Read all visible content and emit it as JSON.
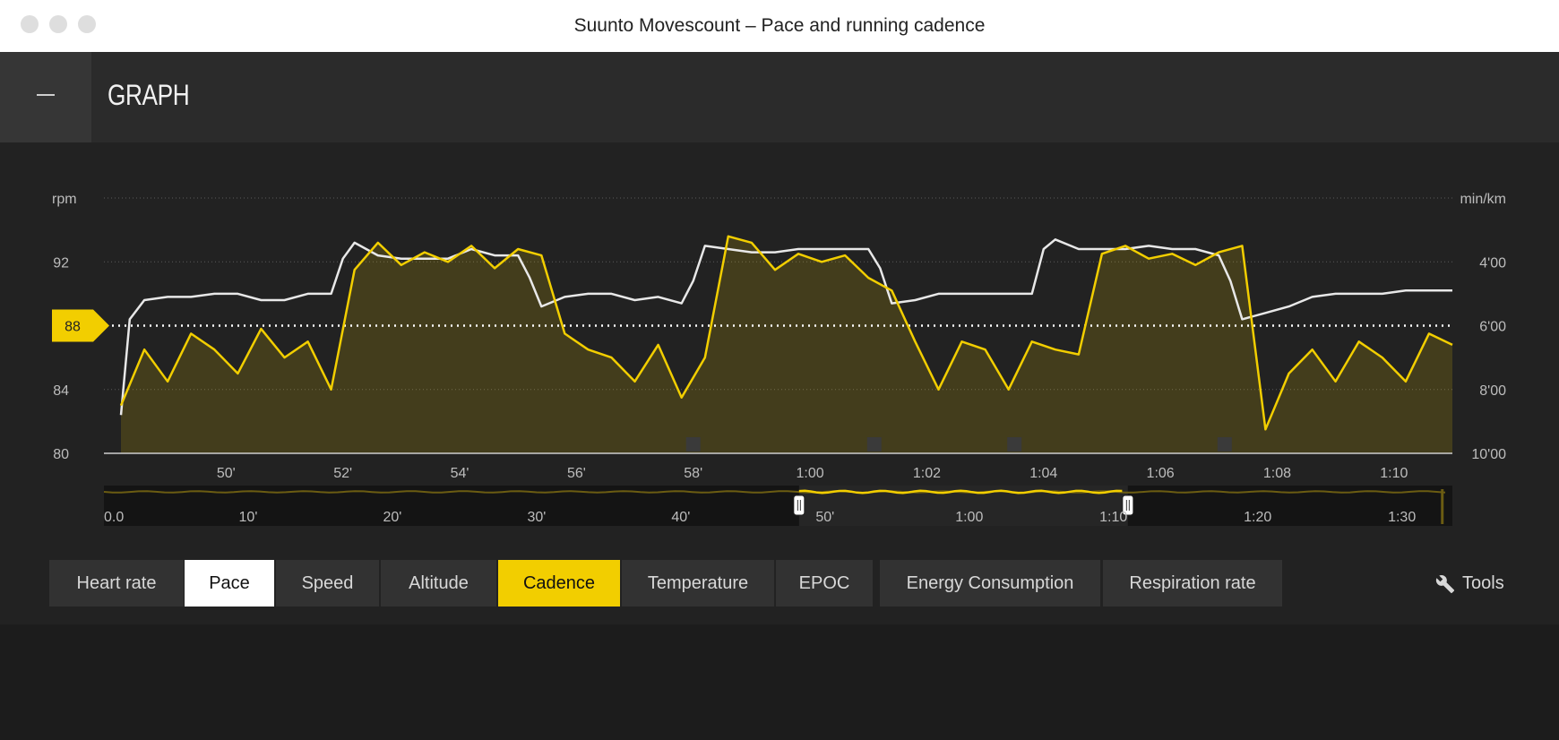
{
  "window": {
    "title": "Suunto Movescount – Pace and running cadence"
  },
  "header": {
    "title": "GRAPH"
  },
  "tabs": [
    "Heart rate",
    "Pace",
    "Speed",
    "Altitude",
    "Cadence",
    "Temperature",
    "EPOC",
    "Energy Consumption",
    "Respiration rate"
  ],
  "active_tabs": [
    "Pace",
    "Cadence"
  ],
  "tools": {
    "label": "Tools",
    "icon": "wrench-icon"
  },
  "colors": {
    "cadence": "#f2ce00",
    "pace": "#e8e8e8",
    "background": "#222222",
    "overlap_fill": "#f2ce00"
  },
  "chart_data": {
    "type": "line",
    "left_axis": {
      "unit": "rpm",
      "ticks": [
        92,
        88,
        84,
        80
      ],
      "range": [
        80,
        96
      ]
    },
    "right_axis": {
      "unit": "min/km",
      "ticks": [
        "4'00",
        "6'00",
        "8'00",
        "10'00"
      ],
      "range_min_per_km": [
        10,
        2
      ]
    },
    "x_axis": {
      "unit": "minutes",
      "ticks": [
        "50'",
        "52'",
        "54'",
        "56'",
        "58'",
        "1:00",
        "1:02",
        "1:04",
        "1:06",
        "1:08",
        "1:10"
      ],
      "range": [
        48.2,
        71.0
      ]
    },
    "marker": {
      "label": "88",
      "value": 88
    },
    "series": [
      {
        "name": "Cadence",
        "x": [
          48.2,
          48.6,
          49.0,
          49.4,
          49.8,
          50.2,
          50.6,
          51.0,
          51.4,
          51.8,
          52.2,
          52.6,
          53.0,
          53.4,
          53.8,
          54.2,
          54.6,
          55.0,
          55.4,
          55.8,
          56.2,
          56.6,
          57.0,
          57.4,
          57.8,
          58.2,
          58.6,
          59.0,
          59.4,
          59.8,
          60.2,
          60.6,
          61.0,
          61.4,
          61.8,
          62.2,
          62.6,
          63.0,
          63.4,
          63.8,
          64.2,
          64.6,
          65.0,
          65.4,
          65.8,
          66.2,
          66.6,
          67.0,
          67.4,
          67.8,
          68.2,
          68.6,
          69.0,
          69.4,
          69.8,
          70.2,
          70.6,
          71.0
        ],
        "values": [
          83.0,
          86.5,
          84.5,
          87.5,
          86.5,
          85.0,
          87.8,
          86.0,
          87.0,
          84.0,
          91.5,
          93.2,
          91.8,
          92.6,
          92.0,
          93.0,
          91.6,
          92.8,
          92.4,
          87.5,
          86.5,
          86.0,
          84.5,
          86.8,
          83.5,
          86.0,
          93.6,
          93.2,
          91.5,
          92.5,
          92.0,
          92.4,
          91.0,
          90.2,
          87.0,
          84.0,
          87.0,
          86.5,
          84.0,
          87.0,
          86.5,
          86.2,
          92.5,
          93.0,
          92.2,
          92.5,
          91.8,
          92.6,
          93.0,
          81.5,
          85.0,
          86.5,
          84.5,
          87.0,
          86.0,
          84.5,
          87.5,
          86.8
        ],
        "color": "#f2ce00"
      },
      {
        "name": "Pace",
        "x": [
          48.2,
          48.35,
          48.6,
          49.0,
          49.4,
          49.8,
          50.2,
          50.6,
          51.0,
          51.4,
          51.8,
          52.0,
          52.2,
          52.6,
          53.0,
          53.4,
          53.8,
          54.2,
          54.6,
          55.0,
          55.2,
          55.4,
          55.8,
          56.2,
          56.6,
          57.0,
          57.4,
          57.8,
          58.0,
          58.2,
          58.6,
          59.0,
          59.4,
          59.8,
          60.2,
          60.6,
          61.0,
          61.2,
          61.4,
          61.8,
          62.2,
          62.6,
          63.0,
          63.4,
          63.8,
          64.0,
          64.2,
          64.6,
          65.0,
          65.4,
          65.8,
          66.2,
          66.6,
          67.0,
          67.2,
          67.4,
          67.8,
          68.2,
          68.6,
          69.0,
          69.4,
          69.8,
          70.2,
          70.6,
          71.0
        ],
        "values": [
          8.8,
          5.8,
          5.2,
          5.1,
          5.1,
          5.0,
          5.0,
          5.2,
          5.2,
          5.0,
          5.0,
          3.9,
          3.4,
          3.8,
          3.9,
          3.9,
          3.9,
          3.6,
          3.8,
          3.8,
          4.5,
          5.4,
          5.1,
          5.0,
          5.0,
          5.2,
          5.1,
          5.3,
          4.6,
          3.5,
          3.6,
          3.7,
          3.7,
          3.6,
          3.6,
          3.6,
          3.6,
          4.2,
          5.3,
          5.2,
          5.0,
          5.0,
          5.0,
          5.0,
          5.0,
          3.6,
          3.3,
          3.6,
          3.6,
          3.6,
          3.5,
          3.6,
          3.6,
          3.8,
          4.6,
          5.8,
          5.6,
          5.4,
          5.1,
          5.0,
          5.0,
          5.0,
          4.9,
          4.9,
          4.9
        ],
        "color": "#e8e8e8"
      }
    ],
    "overview": {
      "ticks": [
        "0.0",
        "10'",
        "20'",
        "30'",
        "40'",
        "50'",
        "1:00",
        "1:10",
        "1:20",
        "1:30"
      ],
      "range": [
        0,
        93.5
      ],
      "selection": [
        48.2,
        71.0
      ]
    }
  }
}
